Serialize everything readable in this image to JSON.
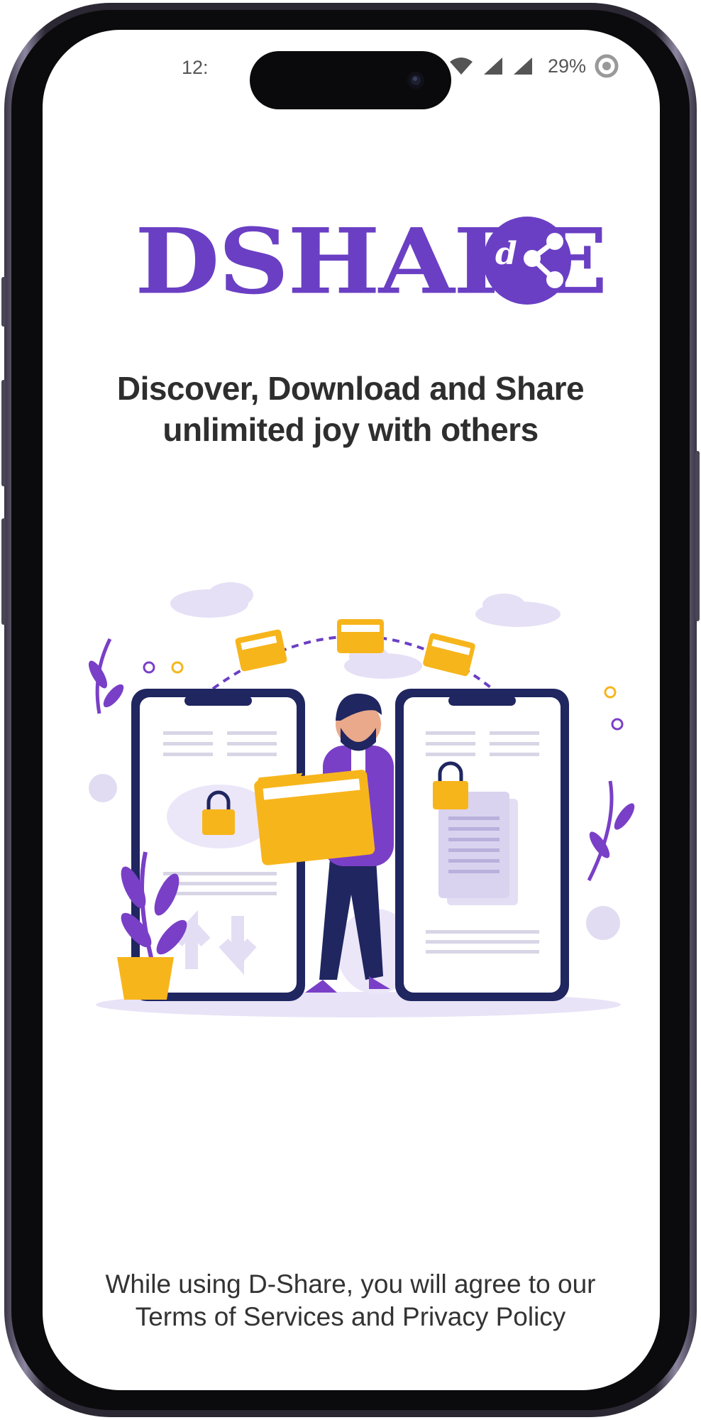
{
  "status_bar": {
    "time": "12:",
    "battery": "29%",
    "icons": [
      "wifi-icon",
      "signal-icon",
      "signal-icon",
      "battery-icon"
    ]
  },
  "logo": {
    "wordmark": "DSHARE",
    "badge_text": "d"
  },
  "tagline": {
    "line1": "Discover, Download and Share",
    "line2": "unlimited joy with others"
  },
  "footer": {
    "line1": "While using D-Share, you will agree to our",
    "terms": "Terms of Services",
    "and": " and ",
    "privacy": "Privacy Policy"
  },
  "colors": {
    "brand_purple": "#6a3fc4",
    "accent_yellow": "#f7b51c",
    "navy": "#1f2660"
  }
}
